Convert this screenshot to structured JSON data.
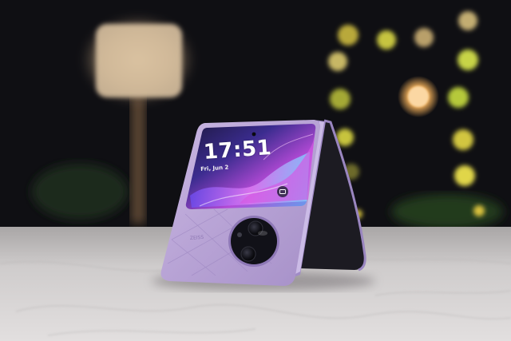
{
  "photo": {
    "subject": "purple flip phone",
    "cover_screen": {
      "time": "17:51",
      "date": "Fri, Jun 2"
    },
    "colors": {
      "phone_body": "#b7a2d6",
      "phone_frame": "#8f7ab5",
      "inner_panel": "#1c1b22",
      "background": "#0b0b0e",
      "table": "#d9d6d6",
      "lamp": "#e8c9a0",
      "bokeh_yellow": "#d8c640"
    }
  }
}
